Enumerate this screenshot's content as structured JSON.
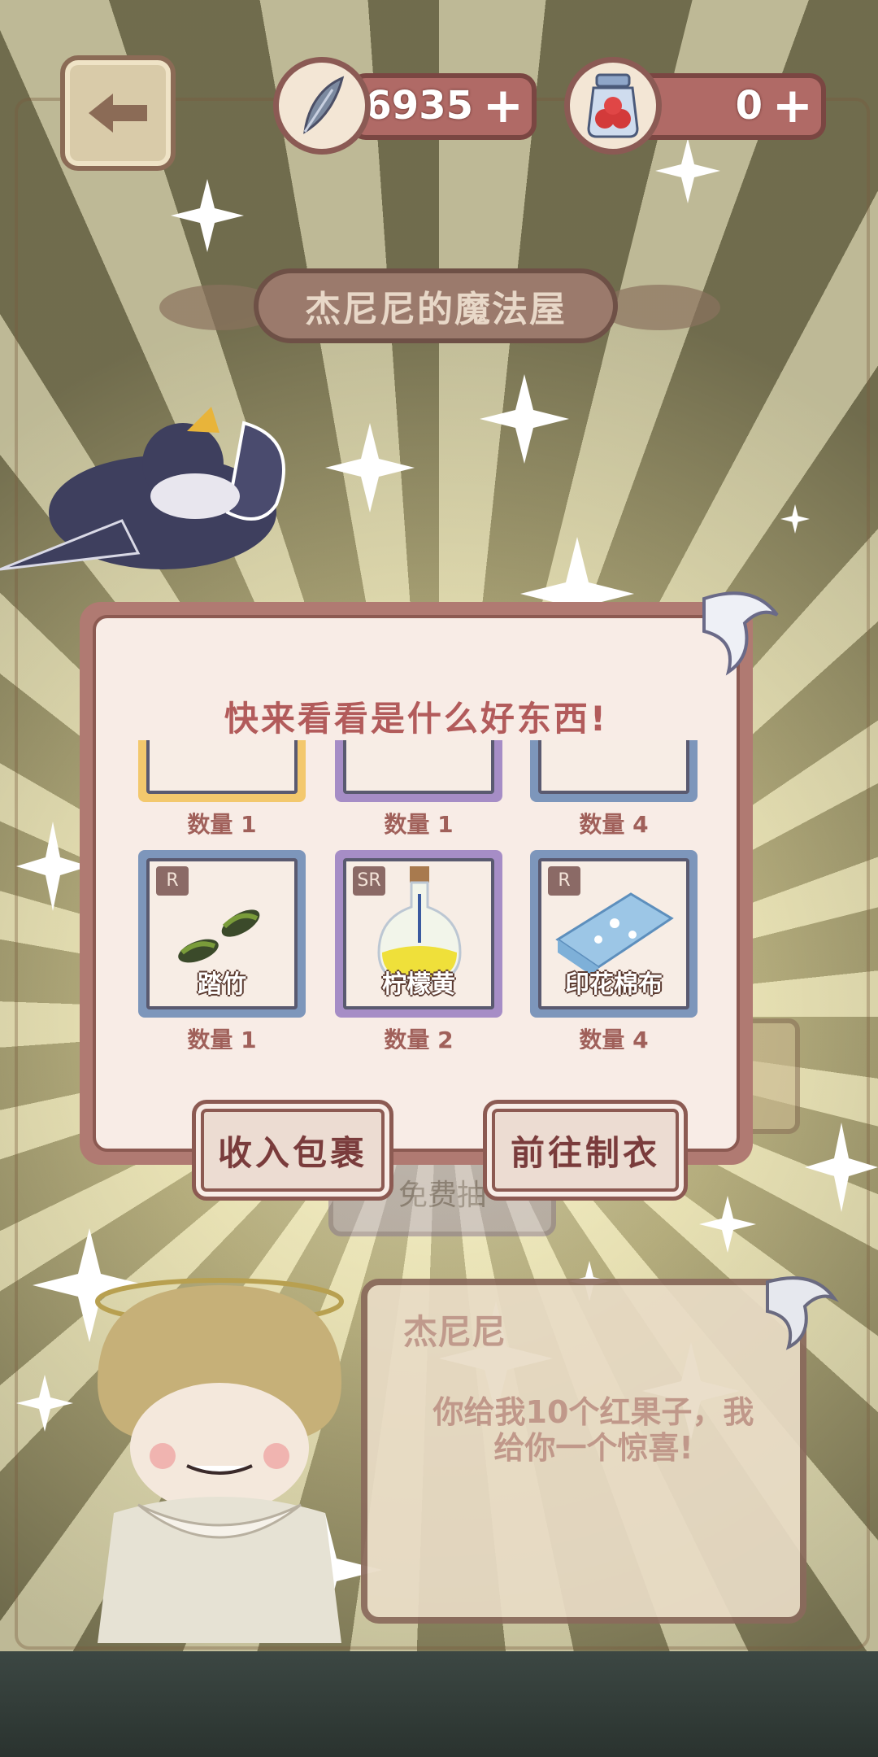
{
  "resources": {
    "feather": {
      "value": "6935",
      "plus": "+",
      "icon": "feather-icon"
    },
    "fruit_jar": {
      "value": "0",
      "plus": "+",
      "icon": "red-fruit-jar-icon"
    }
  },
  "house_title": "杰尼尼的魔法屋",
  "dialog": {
    "title": "快来看看是什么好东西!",
    "rows_partial_top": [
      {
        "qty": "数量 1",
        "rarity_color": "ssr"
      },
      {
        "qty": "数量 1",
        "rarity_color": "sr"
      },
      {
        "qty": "数量 4",
        "rarity_color": "r"
      }
    ],
    "items": [
      {
        "rarity": "R",
        "name": "踏竹",
        "qty": "数量 1",
        "icon": "bamboo-shoes-icon"
      },
      {
        "rarity": "SR",
        "name": "柠檬黄",
        "qty": "数量 2",
        "icon": "yellow-potion-bottle-icon"
      },
      {
        "rarity": "R",
        "name": "印花棉布",
        "qty": "数量 4",
        "icon": "blue-cloth-icon"
      }
    ],
    "collect_button": "收入包裹",
    "goto_button": "前往制衣"
  },
  "free_button": "免费抽",
  "npc": {
    "name": "杰尼尼",
    "message": "你给我10个红果子，我给你一个惊喜!"
  },
  "colors": {
    "accent": "#b25b5b",
    "panel": "#f8ece6",
    "border": "#8c5a52"
  }
}
